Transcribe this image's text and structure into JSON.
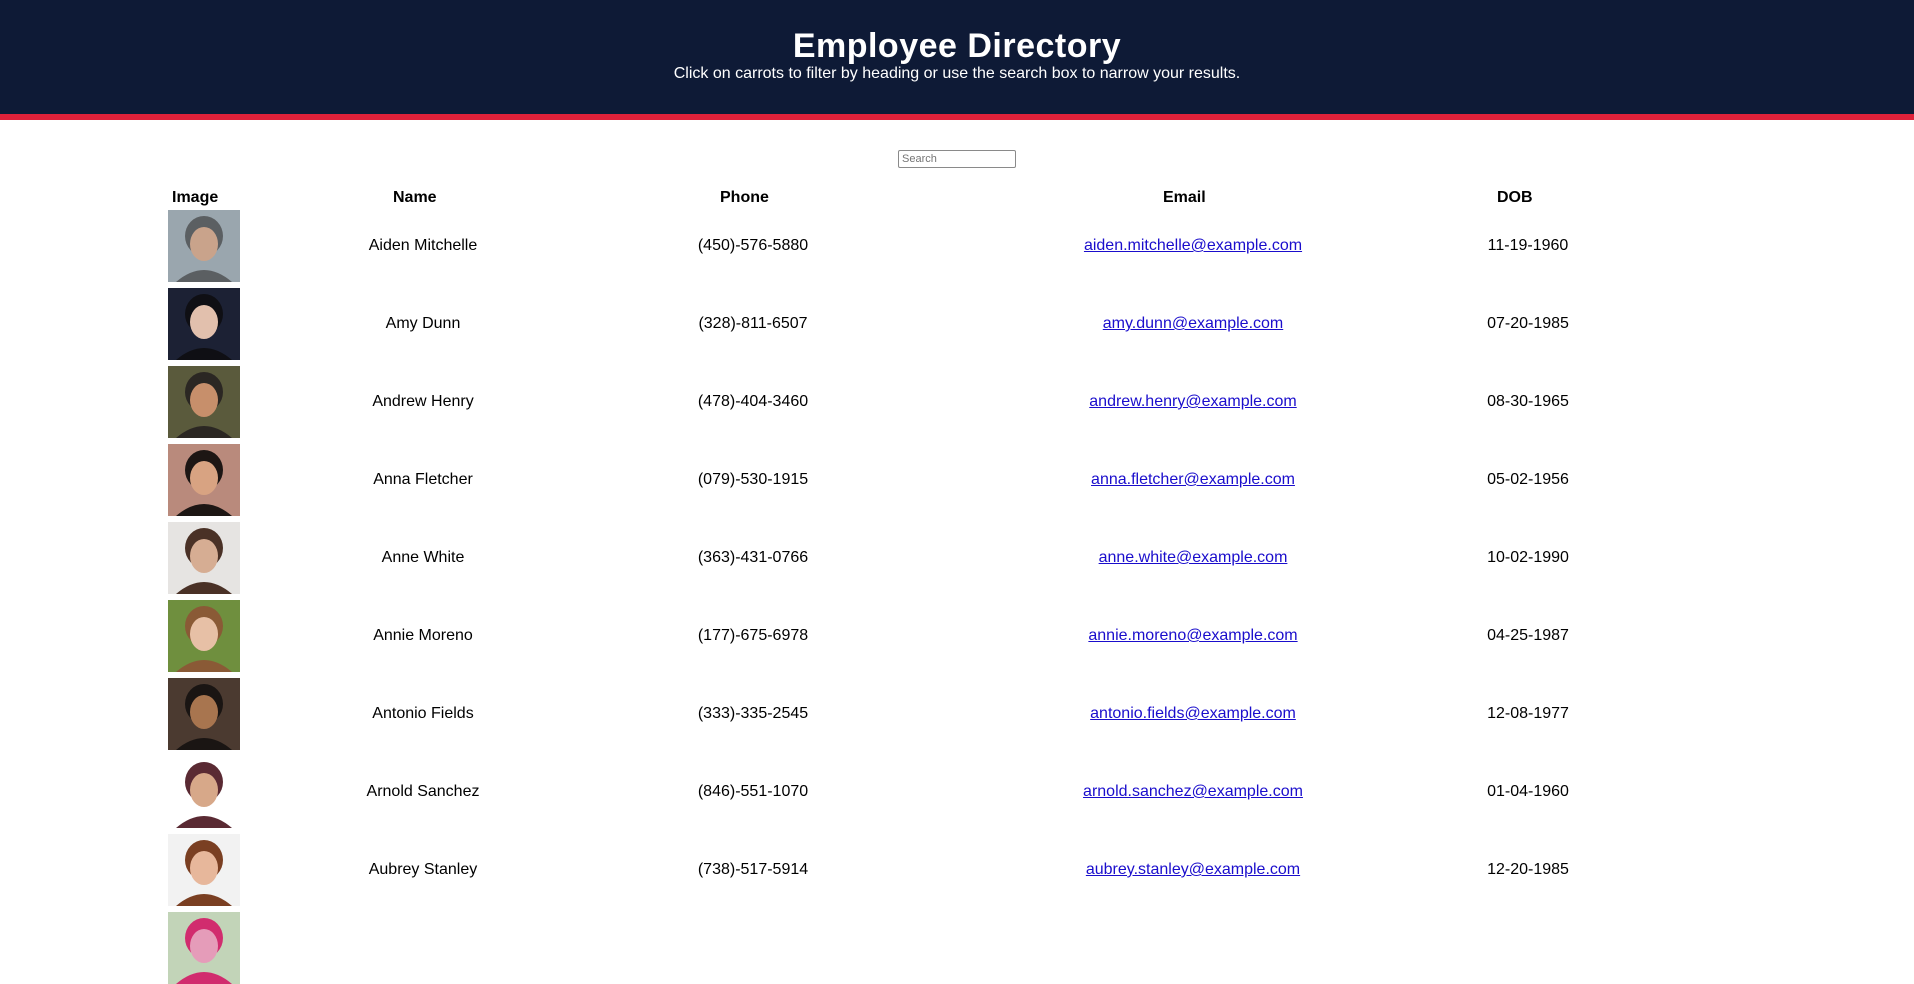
{
  "header": {
    "title": "Employee Directory",
    "subtitle": "Click on carrots to filter by heading or use the search box to narrow your results.",
    "bg_color": "#0e1a36",
    "accent_color": "#e0213a"
  },
  "search": {
    "placeholder": "Search",
    "value": ""
  },
  "table": {
    "columns": [
      "Image",
      "Name",
      "Phone",
      "Email",
      "DOB"
    ],
    "rows": [
      {
        "name": "Aiden Mitchelle",
        "phone": "(450)-576-5880",
        "email": "aiden.mitchelle@example.com",
        "dob": "11-19-1960",
        "photo_colors": [
          "#9aa6ae",
          "#c9a38b",
          "#5b5f62"
        ]
      },
      {
        "name": "Amy Dunn",
        "phone": "(328)-811-6507",
        "email": "amy.dunn@example.com",
        "dob": "07-20-1985",
        "photo_colors": [
          "#1c2134",
          "#e2c0ad",
          "#0f0f14"
        ]
      },
      {
        "name": "Andrew Henry",
        "phone": "(478)-404-3460",
        "email": "andrew.henry@example.com",
        "dob": "08-30-1965",
        "photo_colors": [
          "#5a5a3c",
          "#c78f6b",
          "#2b2723"
        ]
      },
      {
        "name": "Anna Fletcher",
        "phone": "(079)-530-1915",
        "email": "anna.fletcher@example.com",
        "dob": "05-02-1956",
        "photo_colors": [
          "#b98a7c",
          "#d8a382",
          "#1d1614"
        ]
      },
      {
        "name": "Anne White",
        "phone": "(363)-431-0766",
        "email": "anne.white@example.com",
        "dob": "10-02-1990",
        "photo_colors": [
          "#e6e4e2",
          "#d6ad93",
          "#4a3126"
        ]
      },
      {
        "name": "Annie Moreno",
        "phone": "(177)-675-6978",
        "email": "annie.moreno@example.com",
        "dob": "04-25-1987",
        "photo_colors": [
          "#6f8f3e",
          "#e7c0a6",
          "#8a5a36"
        ]
      },
      {
        "name": "Antonio Fields",
        "phone": "(333)-335-2545",
        "email": "antonio.fields@example.com",
        "dob": "12-08-1977",
        "photo_colors": [
          "#4b3a30",
          "#a8754f",
          "#1a1513"
        ]
      },
      {
        "name": "Arnold Sanchez",
        "phone": "(846)-551-1070",
        "email": "arnold.sanchez@example.com",
        "dob": "01-04-1960",
        "photo_colors": [
          "#ffffff",
          "#d7a889",
          "#5a2a33"
        ]
      },
      {
        "name": "Aubrey Stanley",
        "phone": "(738)-517-5914",
        "email": "aubrey.stanley@example.com",
        "dob": "12-20-1985",
        "photo_colors": [
          "#f2f2f2",
          "#e7b79b",
          "#7a3f22"
        ]
      },
      {
        "name": "",
        "phone": "",
        "email": "",
        "dob": "",
        "photo_colors": [
          "#c2d4b8",
          "#e59cb9",
          "#d12c6e"
        ]
      }
    ]
  }
}
